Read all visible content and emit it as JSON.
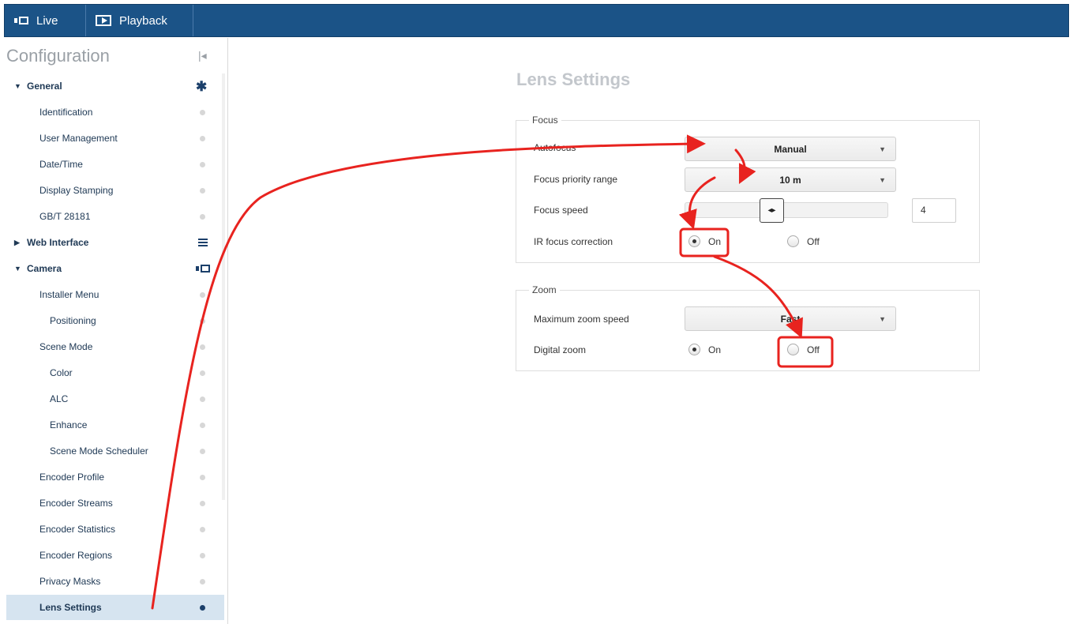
{
  "topbar": {
    "live_label": "Live",
    "playback_label": "Playback"
  },
  "sidebar": {
    "title": "Configuration",
    "items": [
      {
        "label": "General"
      },
      {
        "label": "Identification"
      },
      {
        "label": "User Management"
      },
      {
        "label": "Date/Time"
      },
      {
        "label": "Display Stamping"
      },
      {
        "label": "GB/T 28181"
      },
      {
        "label": "Web Interface"
      },
      {
        "label": "Camera"
      },
      {
        "label": "Installer Menu"
      },
      {
        "label": "Positioning"
      },
      {
        "label": "Scene Mode"
      },
      {
        "label": "Color"
      },
      {
        "label": "ALC"
      },
      {
        "label": "Enhance"
      },
      {
        "label": "Scene Mode Scheduler"
      },
      {
        "label": "Encoder Profile"
      },
      {
        "label": "Encoder Streams"
      },
      {
        "label": "Encoder Statistics"
      },
      {
        "label": "Encoder Regions"
      },
      {
        "label": "Privacy Masks"
      },
      {
        "label": "Lens Settings"
      }
    ]
  },
  "main": {
    "title": "Lens Settings",
    "focus": {
      "legend": "Focus",
      "autofocus_label": "Autofocus",
      "autofocus_value": "Manual",
      "priority_label": "Focus priority range",
      "priority_value": "10 m",
      "speed_label": "Focus speed",
      "speed_value": "4",
      "ir_label": "IR focus correction",
      "ir_on": "On",
      "ir_off": "Off",
      "ir_selected": "On"
    },
    "zoom": {
      "legend": "Zoom",
      "max_speed_label": "Maximum zoom speed",
      "max_speed_value": "Fast",
      "digital_label": "Digital zoom",
      "digital_on": "On",
      "digital_off": "Off",
      "digital_selected": "On"
    }
  },
  "colors": {
    "topbar": "#1b5387",
    "nav_text": "#203a56",
    "active_bg": "#d6e4f0",
    "annotation": "#e8231f"
  }
}
